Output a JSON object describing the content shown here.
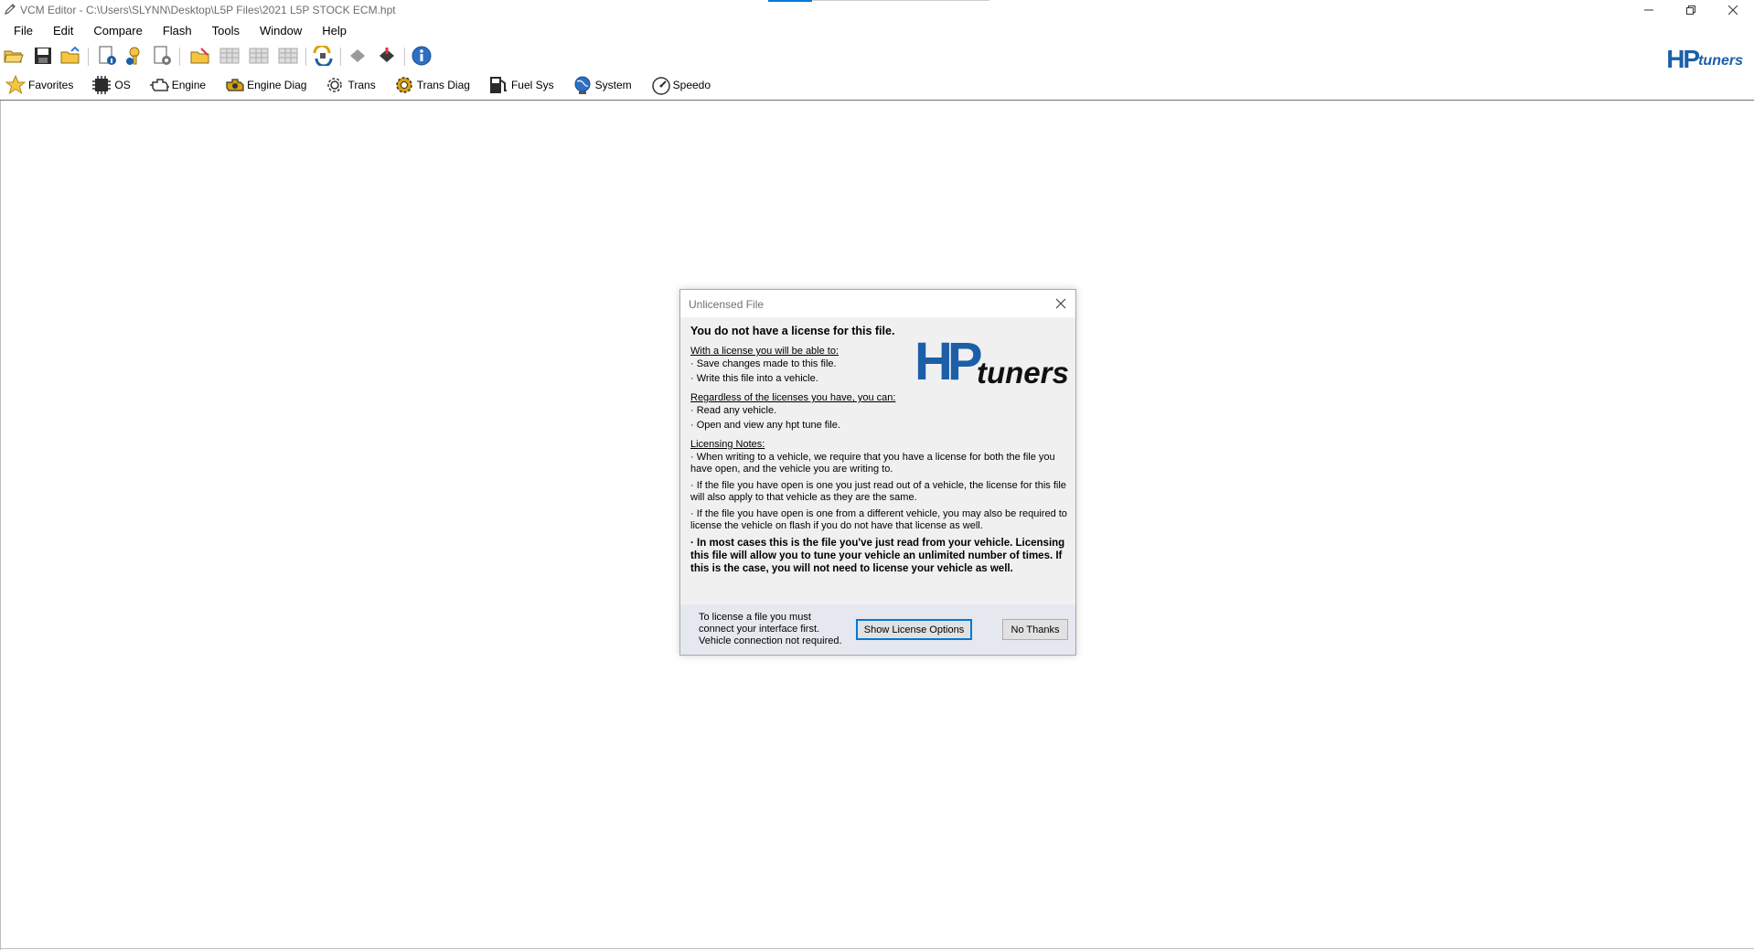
{
  "window": {
    "title": "VCM Editor - C:\\Users\\SLYNN\\Desktop\\L5P Files\\2021 L5P STOCK ECM.hpt"
  },
  "menu": {
    "items": [
      {
        "label": "File"
      },
      {
        "label": "Edit"
      },
      {
        "label": "Compare"
      },
      {
        "label": "Flash"
      },
      {
        "label": "Tools"
      },
      {
        "label": "Window"
      },
      {
        "label": "Help"
      }
    ]
  },
  "categories": [
    {
      "label": "Favorites",
      "icon": "star-icon"
    },
    {
      "label": "OS",
      "icon": "chip-icon"
    },
    {
      "label": "Engine",
      "icon": "engine-icon"
    },
    {
      "label": "Engine Diag",
      "icon": "engine-diag-icon"
    },
    {
      "label": "Trans",
      "icon": "gear-icon"
    },
    {
      "label": "Trans Diag",
      "icon": "gear-diag-icon"
    },
    {
      "label": "Fuel Sys",
      "icon": "fuel-pump-icon"
    },
    {
      "label": "System",
      "icon": "globe-icon"
    },
    {
      "label": "Speedo",
      "icon": "speedometer-icon"
    }
  ],
  "brand": {
    "logo_hp": "HP",
    "logo_tuners": "tuners",
    "color": "#1c5fa8"
  },
  "dialog": {
    "title": "Unlicensed File",
    "heading": "You do not have a license for this file.",
    "section1_title": "With a license you will be able to:",
    "section1_items": [
      "· Save changes made to this file.",
      "· Write this file into a vehicle."
    ],
    "section2_title": "Regardless of the licenses you have, you can:",
    "section2_items": [
      "· Read any vehicle.",
      "· Open and view any hpt tune file."
    ],
    "section3_title": "Licensing Notes:",
    "notes": [
      "· When writing to a vehicle, we require that you have a license for both the file you have open, and the vehicle you are writing to.",
      "· If the file you have open is one you just read out of a vehicle, the license for this file will also apply to that vehicle as they are the same.",
      "· If the file you have open is one from a different vehicle, you may also be required to license the vehicle on flash if you do not have that license as well."
    ],
    "bold_note": "· In most cases this is the file you've just read from your vehicle. Licensing this file will allow you to tune your vehicle an unlimited number of times. If this is the case, you will not need to license your vehicle as well.",
    "footer_lines": [
      "To license a file you must",
      "connect your interface first.",
      "Vehicle connection not required."
    ],
    "primary_button": "Show License Options",
    "secondary_button": "No Thanks"
  }
}
